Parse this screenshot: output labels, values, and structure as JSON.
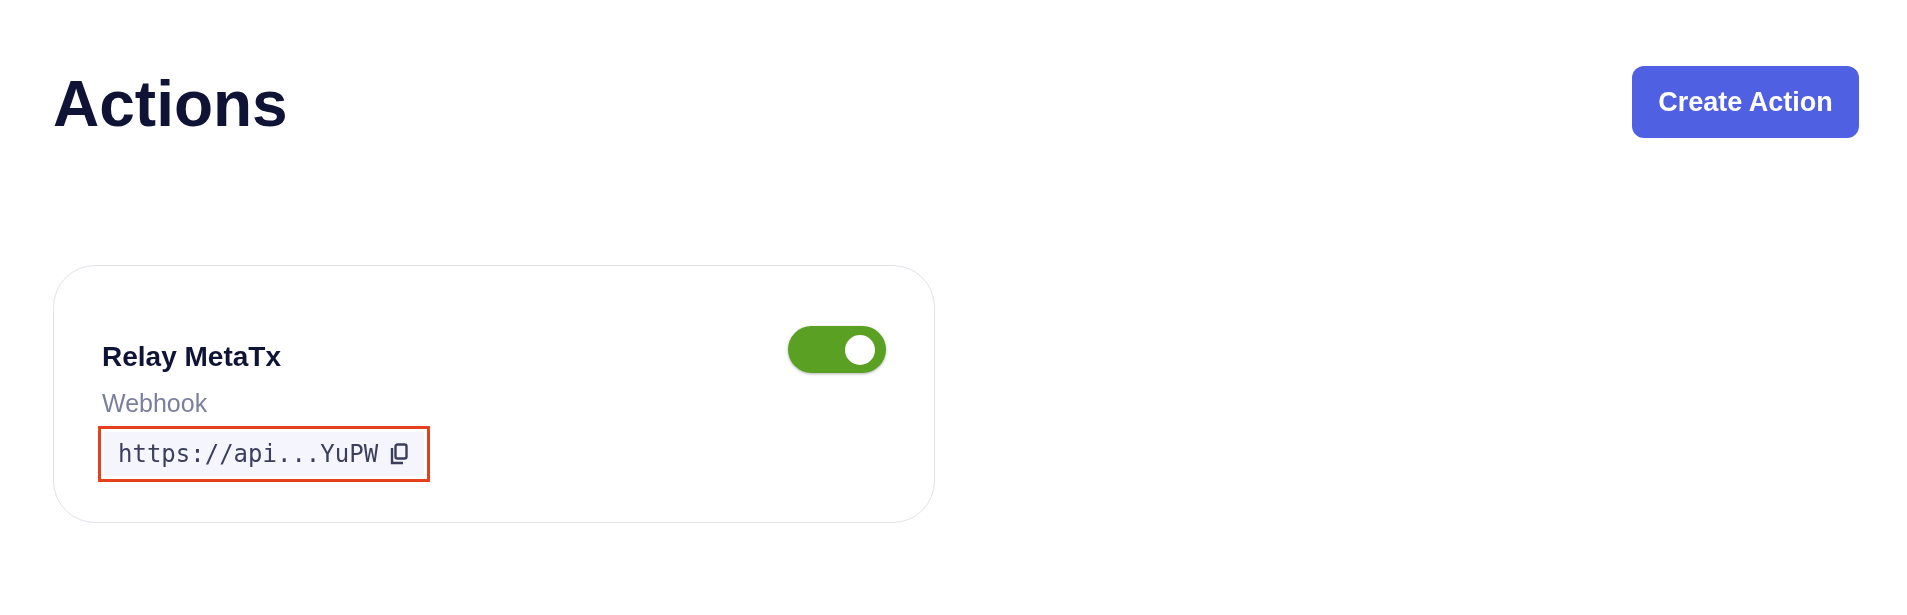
{
  "page": {
    "title": "Actions",
    "create_button": "Create Action"
  },
  "actions": [
    {
      "name": "Relay MetaTx",
      "on": true,
      "type_label": "Webhook",
      "url": "https://api...YuPW",
      "highlighted": true
    }
  ]
}
